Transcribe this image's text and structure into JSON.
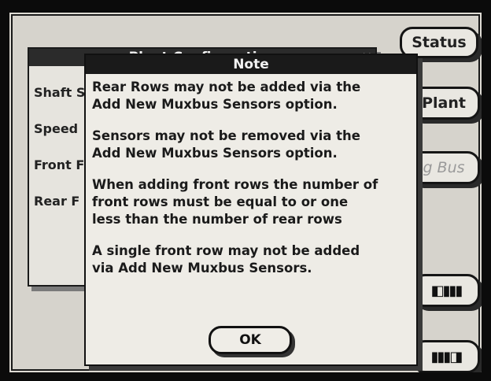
{
  "side_buttons": {
    "status": "Status",
    "plant": "Plant",
    "bus": "g Bus",
    "prev_icon": "arrow-left-icon",
    "next_icon": "arrow-right-icon"
  },
  "background_window": {
    "title": "Plant Configuration",
    "labels": [
      "Shaft S",
      "Speed",
      "Front F",
      "Rear F"
    ]
  },
  "dialog": {
    "title": "Note",
    "messages": [
      "Rear Rows may not be added via the\nAdd New Muxbus Sensors option.",
      "Sensors may not be removed via the\nAdd New Muxbus Sensors option.",
      "When adding front rows the number of\nfront rows must be equal to or one\nless than the number of rear rows",
      "A single front row may not be added\nvia Add New Muxbus Sensors."
    ],
    "ok_label": "OK"
  }
}
